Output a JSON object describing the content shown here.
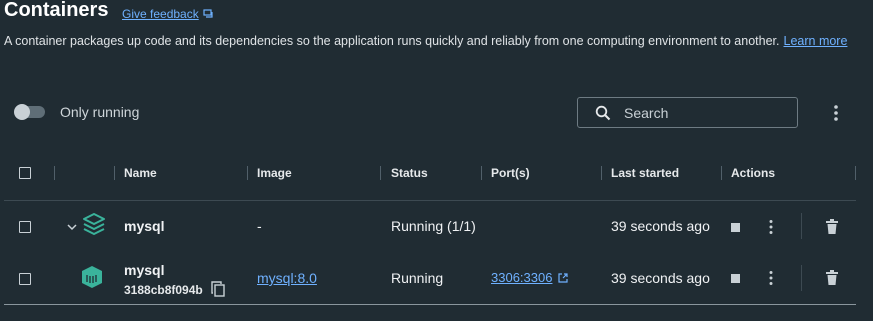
{
  "header": {
    "title": "Containers",
    "feedback_label": "Give feedback",
    "description": "A container packages up code and its dependencies so the application runs quickly and reliably from one computing environment to another.",
    "learn_more": "Learn more"
  },
  "toolbar": {
    "only_running_label": "Only running",
    "only_running_enabled": false,
    "search_placeholder": "Search"
  },
  "table": {
    "columns": [
      "Name",
      "Image",
      "Status",
      "Port(s)",
      "Last started",
      "Actions"
    ],
    "rows": [
      {
        "type": "group",
        "name": "mysql",
        "image": "-",
        "status": "Running (1/1)",
        "ports": "",
        "last_started": "39 seconds ago"
      },
      {
        "type": "container",
        "name": "mysql",
        "id": "3188cb8f094b",
        "image": "mysql:8.0",
        "status": "Running",
        "ports": "3306:3306",
        "last_started": "39 seconds ago"
      }
    ]
  },
  "colors": {
    "background": "#202c33",
    "link": "#6fb1ff",
    "accent_icon": "#3ab39b"
  },
  "icons": [
    "feedback-icon",
    "search-icon",
    "kebab-icon",
    "chevron-down-icon",
    "compose-stack-icon",
    "container-icon",
    "copy-icon",
    "external-link-icon",
    "stop-icon",
    "trash-icon"
  ]
}
